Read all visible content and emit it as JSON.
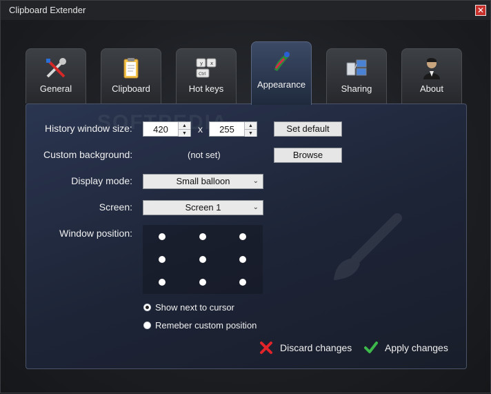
{
  "window": {
    "title": "Clipboard Extender",
    "close_glyph": "✕"
  },
  "tabs": [
    {
      "label": "General",
      "icon": "tools-icon",
      "active": false
    },
    {
      "label": "Clipboard",
      "icon": "clipboard-icon",
      "active": false
    },
    {
      "label": "Hot keys",
      "icon": "keyboard-icon",
      "active": false
    },
    {
      "label": "Appearance",
      "icon": "paint-icon",
      "active": true
    },
    {
      "label": "Sharing",
      "icon": "network-icon",
      "active": false
    },
    {
      "label": "About",
      "icon": "person-icon",
      "active": false
    }
  ],
  "appearance": {
    "history_size_label": "History window size:",
    "width_value": "420",
    "times_glyph": "x",
    "height_value": "255",
    "set_default_label": "Set default",
    "custom_background_label": "Custom background:",
    "custom_background_value": "(not set)",
    "browse_label": "Browse",
    "display_mode_label": "Display mode:",
    "display_mode_value": "Small balloon",
    "screen_label": "Screen:",
    "screen_value": "Screen 1",
    "window_position_label": "Window position:",
    "show_next_to_cursor_label": "Show next to cursor",
    "remember_position_label": "Remeber custom position",
    "selected_position_option": "show_next_to_cursor"
  },
  "actions": {
    "discard_label": "Discard changes",
    "apply_label": "Apply changes"
  },
  "watermark": "SOFTPEDIA",
  "colors": {
    "accent_active_tab": "#3c4a66",
    "discard_red": "#e0242a",
    "apply_green": "#3db84a"
  }
}
